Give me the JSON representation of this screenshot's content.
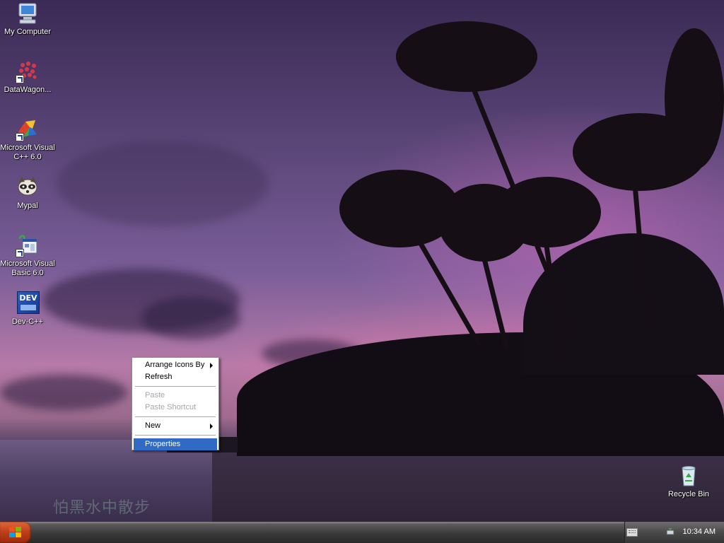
{
  "desktop_icons": [
    {
      "label": "My Computer"
    },
    {
      "label": "DataWagon..."
    },
    {
      "label": "Microsoft Visual C++ 6.0"
    },
    {
      "label": "Mypal"
    },
    {
      "label": "Microsoft Visual Basic 6.0"
    },
    {
      "label": "Dev-C++"
    },
    {
      "label": "Recycle Bin"
    }
  ],
  "dev_icon_text": "DEV",
  "context_menu": {
    "items": [
      {
        "label": "Arrange Icons By",
        "submenu": true,
        "enabled": true
      },
      {
        "label": "Refresh",
        "enabled": true
      },
      {
        "label": "Paste",
        "enabled": false
      },
      {
        "label": "Paste Shortcut",
        "enabled": false
      },
      {
        "label": "New",
        "submenu": true,
        "enabled": true
      },
      {
        "label": "Properties",
        "enabled": true,
        "highlighted": true
      }
    ]
  },
  "wallpaper_watermark": "怕黑水中散步",
  "taskbar": {
    "start_button": "start",
    "tray_icons": [
      "keyboard-icon",
      "safely-remove-icon"
    ],
    "clock": "10:34 AM"
  },
  "colors": {
    "menu_highlight": "#316ac5",
    "disabled_text": "#a7a6aa",
    "start_button": "#c0401a"
  }
}
